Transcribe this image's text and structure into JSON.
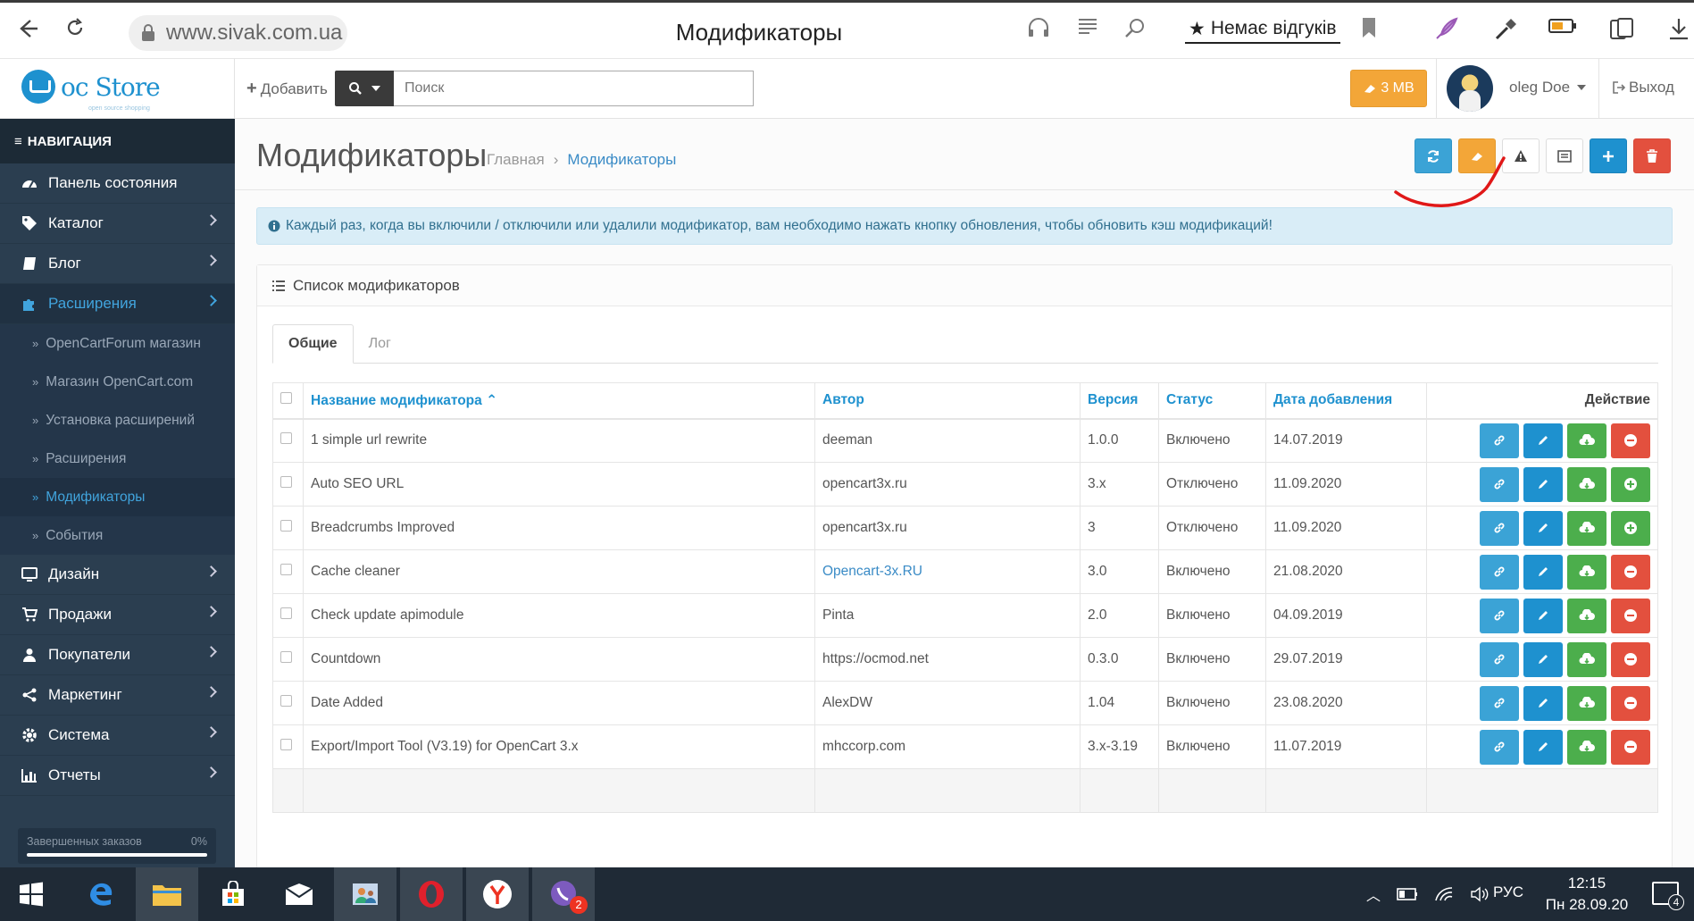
{
  "browser": {
    "url": "www.sivak.com.ua",
    "tab_title": "Модификаторы",
    "reviews_label": "Немає відгуків"
  },
  "header": {
    "logo_text": "oc Store",
    "logo_subtext": "open source shopping",
    "add_label": "Добавить",
    "search_placeholder": "Поиск",
    "mb_label": "3 MB",
    "user_name": "oleg Doe",
    "logout_label": "Выход"
  },
  "sidebar": {
    "title": "НАВИГАЦИЯ",
    "items": [
      {
        "label": "Панель состояния",
        "icon": "dashboard-icon"
      },
      {
        "label": "Каталог",
        "icon": "tag-icon"
      },
      {
        "label": "Блог",
        "icon": "book-icon"
      },
      {
        "label": "Расширения",
        "icon": "puzzle-icon"
      },
      {
        "label": "Дизайн",
        "icon": "desktop-icon"
      },
      {
        "label": "Продажи",
        "icon": "cart-icon"
      },
      {
        "label": "Покупатели",
        "icon": "user-icon"
      },
      {
        "label": "Маркетинг",
        "icon": "share-icon"
      },
      {
        "label": "Система",
        "icon": "gear-icon"
      },
      {
        "label": "Отчеты",
        "icon": "bar-chart-icon"
      }
    ],
    "subitems": [
      "OpenCartForum магазин",
      "Магазин OpenCart.com",
      "Установка расширений",
      "Расширения",
      "Модификаторы",
      "События"
    ],
    "progress": {
      "label": "Завершенных заказов",
      "value": "0%"
    }
  },
  "page": {
    "title": "Модификаторы",
    "breadcrumb": [
      "Главная",
      "Модификаторы"
    ],
    "alert": "Каждый раз, когда вы включили / отключили или удалили модификатор, вам необходимо нажать кнопку обновления, чтобы обновить кэш модификаций!",
    "panel_title": "Список модификаторов",
    "tabs": [
      "Общие",
      "Лог"
    ]
  },
  "table": {
    "headers": {
      "name": "Название модификатора",
      "author": "Автор",
      "version": "Версия",
      "status": "Статус",
      "date": "Дата добавления",
      "action": "Действие"
    },
    "rows": [
      {
        "name": "1 simple url rewrite",
        "author": "deeman",
        "version": "1.0.0",
        "status": "Включено",
        "date": "14.07.2019"
      },
      {
        "name": "Auto SEO URL",
        "author": "opencart3x.ru",
        "version": "3.x",
        "status": "Отключено",
        "date": "11.09.2020"
      },
      {
        "name": "Breadcrumbs Improved",
        "author": "opencart3x.ru",
        "version": "3",
        "status": "Отключено",
        "date": "11.09.2020"
      },
      {
        "name": "Cache cleaner",
        "author": "Opencart-3x.RU",
        "version": "3.0",
        "status": "Включено",
        "date": "21.08.2020"
      },
      {
        "name": "Check update apimodule",
        "author": "Pinta",
        "version": "2.0",
        "status": "Включено",
        "date": "04.09.2019"
      },
      {
        "name": "Countdown",
        "author": "https://ocmod.net",
        "version": "0.3.0",
        "status": "Включено",
        "date": "29.07.2019"
      },
      {
        "name": "Date Added",
        "author": "AlexDW",
        "version": "1.04",
        "status": "Включено",
        "date": "23.08.2020"
      },
      {
        "name": "Export/Import Tool (V3.19) for OpenCart 3.x",
        "author": "mhccorp.com",
        "version": "3.x-3.19",
        "status": "Включено",
        "date": "11.07.2019"
      }
    ]
  },
  "taskbar": {
    "time": "12:15",
    "date": "Пн 28.09.20",
    "lang": "РУС",
    "viber_badge": "2",
    "notif_count": "4"
  },
  "colors": {
    "sidebar": "#2b3e50",
    "accent": "#1e91cf",
    "warning": "#f3a638",
    "danger": "#e3503e",
    "success": "#4cae4c"
  }
}
